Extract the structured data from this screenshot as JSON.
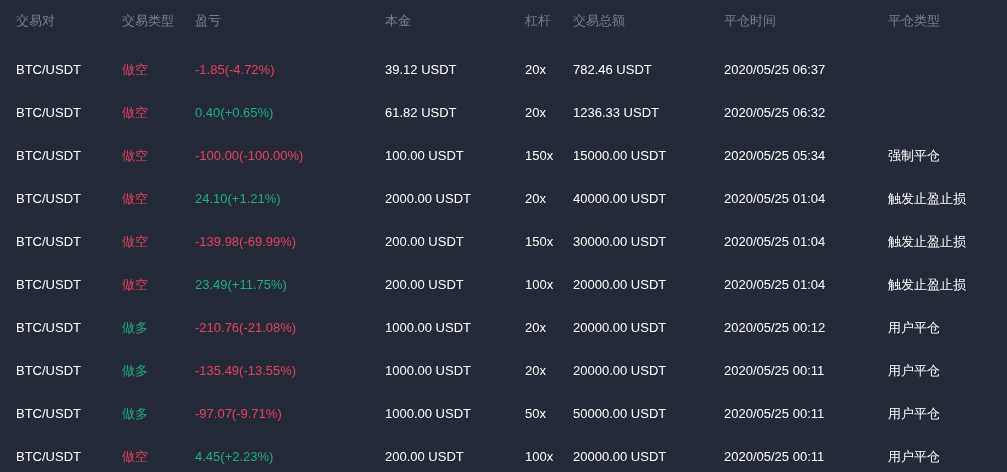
{
  "table": {
    "columns": [
      "交易对",
      "交易类型",
      "盈亏",
      "本金",
      "杠杆",
      "交易总额",
      "平仓时间",
      "平仓类型"
    ],
    "rows": [
      {
        "pair": "BTC/USDT",
        "side": {
          "text": "做空",
          "color": "#e0445d"
        },
        "pnl": {
          "text": "-1.85(-4.72%)",
          "color": "#e0445d"
        },
        "principal": "39.12 USDT",
        "leverage": "20x",
        "total": "782.46 USDT",
        "close_time": "2020/05/25 06:37"
      },
      {
        "pair": "BTC/USDT",
        "side": {
          "text": "做空",
          "color": "#e0445d"
        },
        "pnl": {
          "text": "0.40(+0.65%)",
          "color": "#1fae7f"
        },
        "principal": "61.82 USDT",
        "leverage": "20x",
        "total": "1236.33 USDT",
        "close_time": "2020/05/25 06:32"
      },
      {
        "pair": "BTC/USDT",
        "side": {
          "text": "做空",
          "color": "#e0445d"
        },
        "pnl": {
          "text": "-100.00(-100.00%)",
          "color": "#e0445d"
        },
        "principal": "100.00 USDT",
        "leverage": "150x",
        "total": "15000.00 USDT",
        "close_time": "2020/05/25 05:34",
        "close_type": "强制平仓"
      },
      {
        "pair": "BTC/USDT",
        "side": {
          "text": "做空",
          "color": "#e0445d"
        },
        "pnl": {
          "text": "24.10(+1.21%)",
          "color": "#1fae7f"
        },
        "principal": "2000.00 USDT",
        "leverage": "20x",
        "total": "40000.00 USDT",
        "close_time": "2020/05/25 01:04",
        "close_type": "触发止盈止损"
      },
      {
        "pair": "BTC/USDT",
        "side": {
          "text": "做空",
          "color": "#e0445d"
        },
        "pnl": {
          "text": "-139.98(-69.99%)",
          "color": "#e0445d"
        },
        "principal": "200.00 USDT",
        "leverage": "150x",
        "total": "30000.00 USDT",
        "close_time": "2020/05/25 01:04",
        "close_type": "触发止盈止损"
      },
      {
        "pair": "BTC/USDT",
        "side": {
          "text": "做空",
          "color": "#e0445d"
        },
        "pnl": {
          "text": "23.49(+11.75%)",
          "color": "#1fae7f"
        },
        "principal": "200.00 USDT",
        "leverage": "100x",
        "total": "20000.00 USDT",
        "close_time": "2020/05/25 01:04",
        "close_type": "触发止盈止损"
      },
      {
        "pair": "BTC/USDT",
        "side": {
          "text": "做多",
          "color": "#1fae7f"
        },
        "pnl": {
          "text": "-210.76(-21.08%)",
          "color": "#e0445d"
        },
        "principal": "1000.00 USDT",
        "leverage": "20x",
        "total": "20000.00 USDT",
        "close_time": "2020/05/25 00:12",
        "close_type": "用户平仓"
      },
      {
        "pair": "BTC/USDT",
        "side": {
          "text": "做多",
          "color": "#1fae7f"
        },
        "pnl": {
          "text": "-135.49(-13.55%)",
          "color": "#e0445d"
        },
        "principal": "1000.00 USDT",
        "leverage": "20x",
        "total": "20000.00 USDT",
        "close_time": "2020/05/25 00:11",
        "close_type": "用户平仓"
      },
      {
        "pair": "BTC/USDT",
        "side": {
          "text": "做多",
          "color": "#1fae7f"
        },
        "pnl": {
          "text": "-97.07(-9.71%)",
          "color": "#e0445d"
        },
        "principal": "1000.00 USDT",
        "leverage": "50x",
        "total": "50000.00 USDT",
        "close_time": "2020/05/25 00:11",
        "close_type": "用户平仓"
      },
      {
        "pair": "BTC/USDT",
        "side": {
          "text": "做空",
          "color": "#e0445d"
        },
        "pnl": {
          "text": "4.45(+2.23%)",
          "color": "#1fae7f"
        },
        "principal": "200.00 USDT",
        "leverage": "100x",
        "total": "20000.00 USDT",
        "close_time": "2020/05/25 00:11",
        "close_type": "用户平仓"
      }
    ]
  }
}
